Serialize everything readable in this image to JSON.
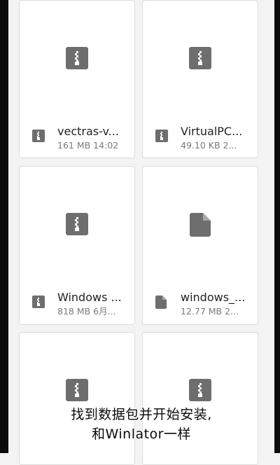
{
  "files": [
    {
      "name": "vectras-v...",
      "meta": "161 MB 14:02",
      "type": "archive"
    },
    {
      "name": "VirtualPC...",
      "meta": "49.10 KB 2...",
      "type": "archive"
    },
    {
      "name": "Windows ...",
      "meta": "818 MB 6月...",
      "type": "archive"
    },
    {
      "name": "windows_...",
      "meta": "12.77 MB 2...",
      "type": "document"
    },
    {
      "name": "",
      "meta": "",
      "type": "archive"
    },
    {
      "name": "",
      "meta": "",
      "type": "archive"
    }
  ],
  "subtitle": {
    "line1": "找到数据包并开始安装,",
    "line2": "和Winlator一样"
  },
  "colors": {
    "icon": "#6e6e6e",
    "background": "#f3f3f3",
    "card": "#ffffff",
    "edge": "#0c0c0c"
  },
  "icons": {
    "archive": "zip-archive-icon",
    "document": "document-icon"
  }
}
